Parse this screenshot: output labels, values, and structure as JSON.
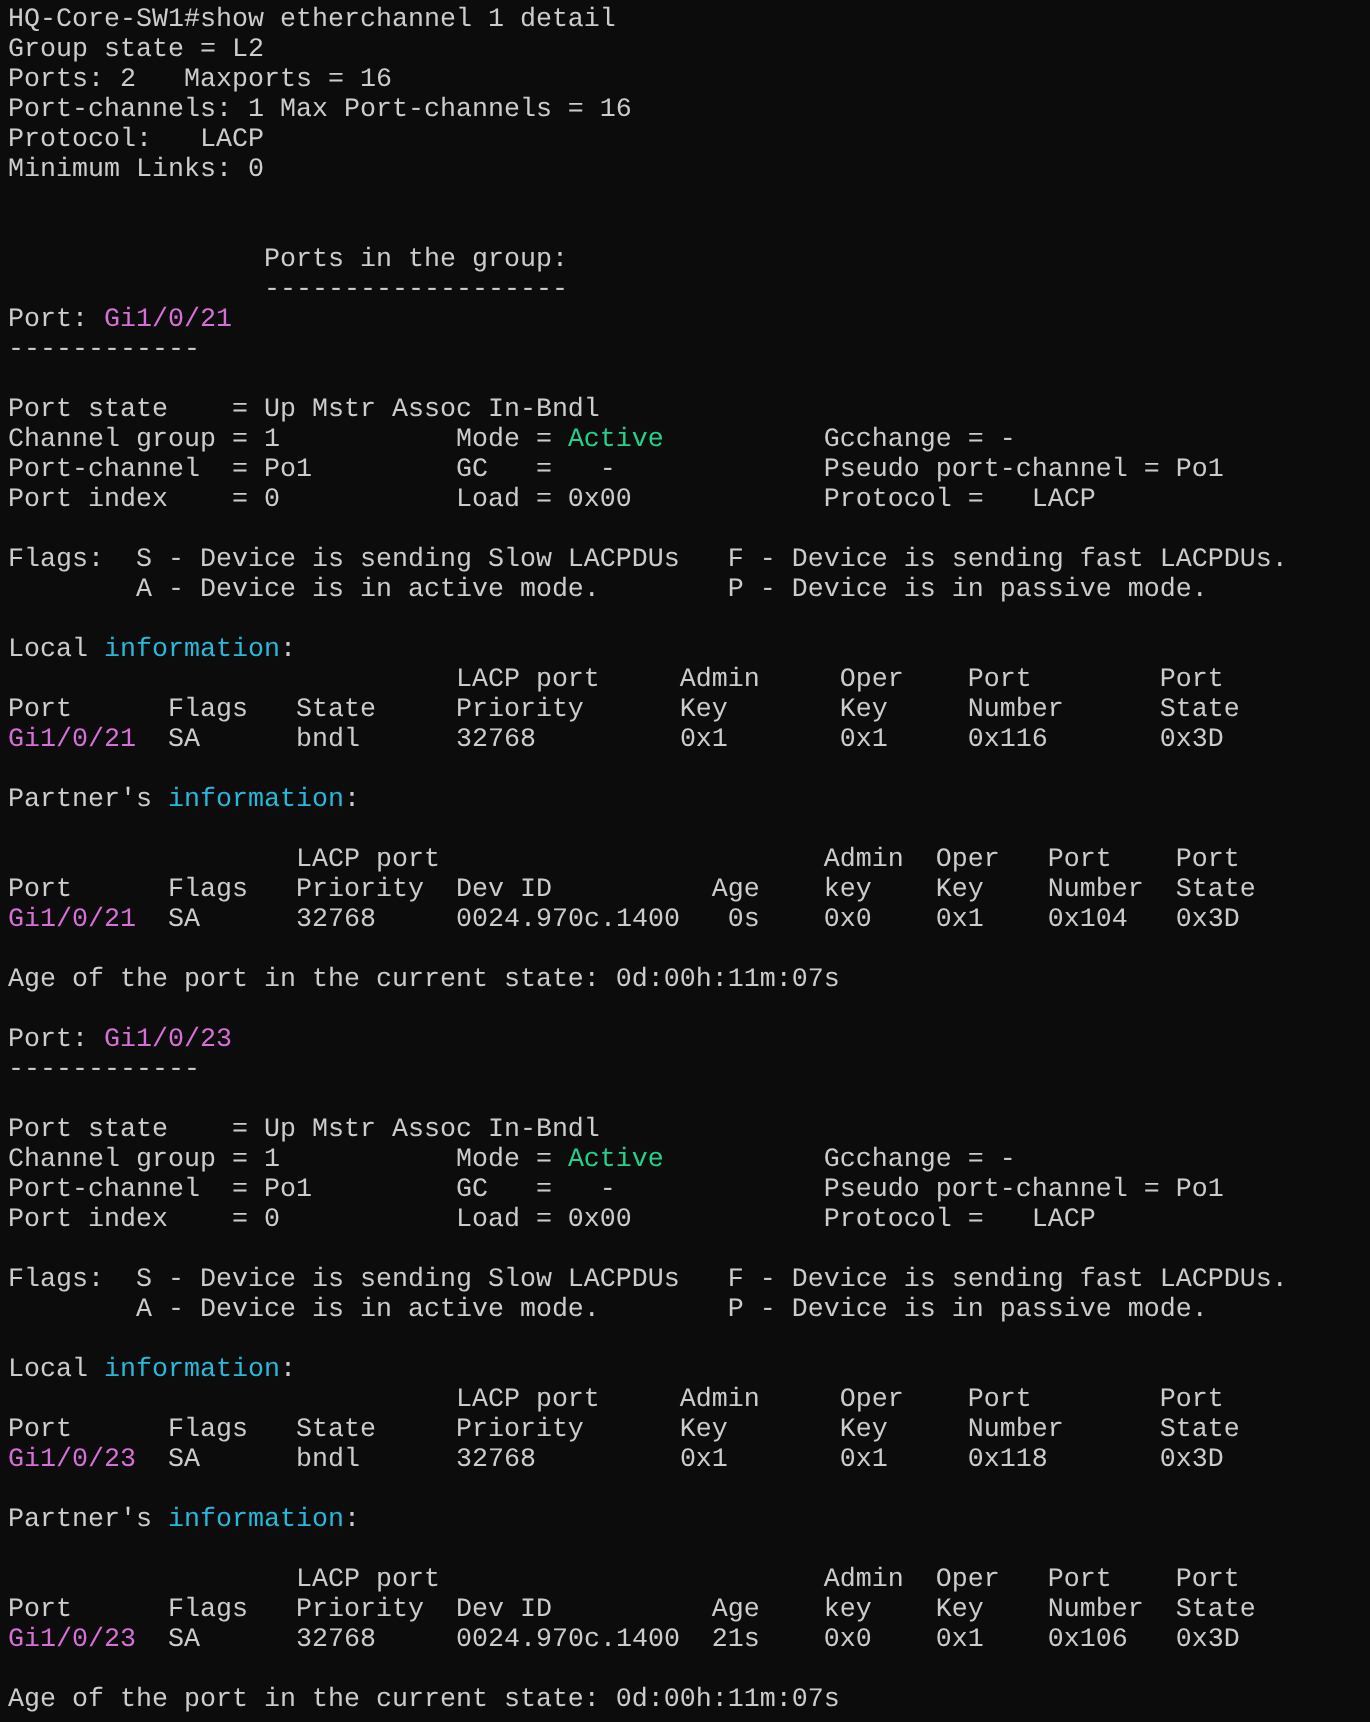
{
  "terminal": {
    "lines": [
      {
        "kind": "text",
        "segments": [
          {
            "text": "HQ-Core-SW1#show etherchannel 1 detail",
            "kind": "plain"
          }
        ]
      },
      {
        "kind": "text",
        "segments": [
          {
            "text": "Group state = L2",
            "kind": "plain"
          }
        ]
      },
      {
        "kind": "text",
        "segments": [
          {
            "text": "Ports: 2   Maxports = 16",
            "kind": "plain"
          }
        ]
      },
      {
        "kind": "text",
        "segments": [
          {
            "text": "Port-channels: 1 Max Port-channels = 16",
            "kind": "plain"
          }
        ]
      },
      {
        "kind": "text",
        "segments": [
          {
            "text": "Protocol:   LACP",
            "kind": "plain"
          }
        ]
      },
      {
        "kind": "text",
        "segments": [
          {
            "text": "Minimum Links: 0",
            "kind": "plain"
          }
        ]
      },
      {
        "kind": "blank"
      },
      {
        "kind": "blank"
      },
      {
        "kind": "text",
        "segments": [
          {
            "text": "                Ports in the group:",
            "kind": "plain"
          }
        ]
      },
      {
        "kind": "text",
        "segments": [
          {
            "text": "                -------------------",
            "kind": "plain"
          }
        ]
      },
      {
        "kind": "text",
        "segments": [
          {
            "text": "Port: ",
            "kind": "plain"
          },
          {
            "text": "Gi1/0/21",
            "kind": "port"
          }
        ]
      },
      {
        "kind": "text",
        "segments": [
          {
            "text": "------------",
            "kind": "plain"
          }
        ]
      },
      {
        "kind": "blank"
      },
      {
        "kind": "text",
        "segments": [
          {
            "text": "Port state    = Up Mstr Assoc In-Bndl",
            "kind": "plain"
          }
        ]
      },
      {
        "kind": "text",
        "segments": [
          {
            "text": "Channel group = 1           Mode = ",
            "kind": "plain"
          },
          {
            "text": "Active",
            "kind": "active"
          },
          {
            "text": "          Gcchange = -",
            "kind": "plain"
          }
        ]
      },
      {
        "kind": "text",
        "segments": [
          {
            "text": "Port-channel  = Po1         GC   =   -             Pseudo port-channel = Po1",
            "kind": "plain"
          }
        ]
      },
      {
        "kind": "text",
        "segments": [
          {
            "text": "Port index    = 0           Load = 0x00            Protocol =   LACP",
            "kind": "plain"
          }
        ]
      },
      {
        "kind": "blank"
      },
      {
        "kind": "text",
        "segments": [
          {
            "text": "Flags:  S - Device is sending Slow LACPDUs   F - Device is sending fast LACPDUs.",
            "kind": "plain"
          }
        ]
      },
      {
        "kind": "text",
        "segments": [
          {
            "text": "        A - Device is in active mode.        P - Device is in passive mode.",
            "kind": "plain"
          }
        ]
      },
      {
        "kind": "blank"
      },
      {
        "kind": "text",
        "segments": [
          {
            "text": "Local ",
            "kind": "plain"
          },
          {
            "text": "information",
            "kind": "info"
          },
          {
            "text": ":",
            "kind": "plain"
          }
        ]
      },
      {
        "kind": "text",
        "segments": [
          {
            "text": "                            LACP port     Admin     Oper    Port        Port",
            "kind": "plain"
          }
        ]
      },
      {
        "kind": "text",
        "segments": [
          {
            "text": "Port      Flags   State     Priority      Key       Key     Number      State",
            "kind": "plain"
          }
        ]
      },
      {
        "kind": "text",
        "segments": [
          {
            "text": "Gi1/0/21",
            "kind": "port"
          },
          {
            "text": "  SA      bndl      32768         0x1       0x1     0x116       0x3D",
            "kind": "plain"
          }
        ]
      },
      {
        "kind": "blank"
      },
      {
        "kind": "text",
        "segments": [
          {
            "text": "Partner's ",
            "kind": "plain"
          },
          {
            "text": "information",
            "kind": "info"
          },
          {
            "text": ":",
            "kind": "plain"
          }
        ]
      },
      {
        "kind": "blank"
      },
      {
        "kind": "text",
        "segments": [
          {
            "text": "                  LACP port                        Admin  Oper   Port    Port",
            "kind": "plain"
          }
        ]
      },
      {
        "kind": "text",
        "segments": [
          {
            "text": "Port      Flags   Priority  Dev ID          Age    key    Key    Number  State",
            "kind": "plain"
          }
        ]
      },
      {
        "kind": "text",
        "segments": [
          {
            "text": "Gi1/0/21",
            "kind": "port"
          },
          {
            "text": "  SA      32768     0024.970c.1400   0s    0x0    0x1    0x104   0x3D",
            "kind": "plain"
          }
        ]
      },
      {
        "kind": "blank"
      },
      {
        "kind": "text",
        "segments": [
          {
            "text": "Age of the port in the current state: 0d:00h:11m:07s",
            "kind": "plain"
          }
        ]
      },
      {
        "kind": "blank"
      },
      {
        "kind": "text",
        "segments": [
          {
            "text": "Port: ",
            "kind": "plain"
          },
          {
            "text": "Gi1/0/23",
            "kind": "port"
          }
        ]
      },
      {
        "kind": "text",
        "segments": [
          {
            "text": "------------",
            "kind": "plain"
          }
        ]
      },
      {
        "kind": "blank"
      },
      {
        "kind": "text",
        "segments": [
          {
            "text": "Port state    = Up Mstr Assoc In-Bndl",
            "kind": "plain"
          }
        ]
      },
      {
        "kind": "text",
        "segments": [
          {
            "text": "Channel group = 1           Mode = ",
            "kind": "plain"
          },
          {
            "text": "Active",
            "kind": "active"
          },
          {
            "text": "          Gcchange = -",
            "kind": "plain"
          }
        ]
      },
      {
        "kind": "text",
        "segments": [
          {
            "text": "Port-channel  = Po1         GC   =   -             Pseudo port-channel = Po1",
            "kind": "plain"
          }
        ]
      },
      {
        "kind": "text",
        "segments": [
          {
            "text": "Port index    = 0           Load = 0x00            Protocol =   LACP",
            "kind": "plain"
          }
        ]
      },
      {
        "kind": "blank"
      },
      {
        "kind": "text",
        "segments": [
          {
            "text": "Flags:  S - Device is sending Slow LACPDUs   F - Device is sending fast LACPDUs.",
            "kind": "plain"
          }
        ]
      },
      {
        "kind": "text",
        "segments": [
          {
            "text": "        A - Device is in active mode.        P - Device is in passive mode.",
            "kind": "plain"
          }
        ]
      },
      {
        "kind": "blank"
      },
      {
        "kind": "text",
        "segments": [
          {
            "text": "Local ",
            "kind": "plain"
          },
          {
            "text": "information",
            "kind": "info"
          },
          {
            "text": ":",
            "kind": "plain"
          }
        ]
      },
      {
        "kind": "text",
        "segments": [
          {
            "text": "                            LACP port     Admin     Oper    Port        Port",
            "kind": "plain"
          }
        ]
      },
      {
        "kind": "text",
        "segments": [
          {
            "text": "Port      Flags   State     Priority      Key       Key     Number      State",
            "kind": "plain"
          }
        ]
      },
      {
        "kind": "text",
        "segments": [
          {
            "text": "Gi1/0/23",
            "kind": "port"
          },
          {
            "text": "  SA      bndl      32768         0x1       0x1     0x118       0x3D",
            "kind": "plain"
          }
        ]
      },
      {
        "kind": "blank"
      },
      {
        "kind": "text",
        "segments": [
          {
            "text": "Partner's ",
            "kind": "plain"
          },
          {
            "text": "information",
            "kind": "info"
          },
          {
            "text": ":",
            "kind": "plain"
          }
        ]
      },
      {
        "kind": "blank"
      },
      {
        "kind": "text",
        "segments": [
          {
            "text": "                  LACP port                        Admin  Oper   Port    Port",
            "kind": "plain"
          }
        ]
      },
      {
        "kind": "text",
        "segments": [
          {
            "text": "Port      Flags   Priority  Dev ID          Age    key    Key    Number  State",
            "kind": "plain"
          }
        ]
      },
      {
        "kind": "text",
        "segments": [
          {
            "text": "Gi1/0/23",
            "kind": "port"
          },
          {
            "text": "  SA      32768     0024.970c.1400  21s    0x0    0x1    0x106   0x3D",
            "kind": "plain"
          }
        ]
      },
      {
        "kind": "blank"
      },
      {
        "kind": "text",
        "segments": [
          {
            "text": "Age of the port in the current state: 0d:00h:11m:07s",
            "kind": "plain"
          }
        ]
      }
    ]
  }
}
